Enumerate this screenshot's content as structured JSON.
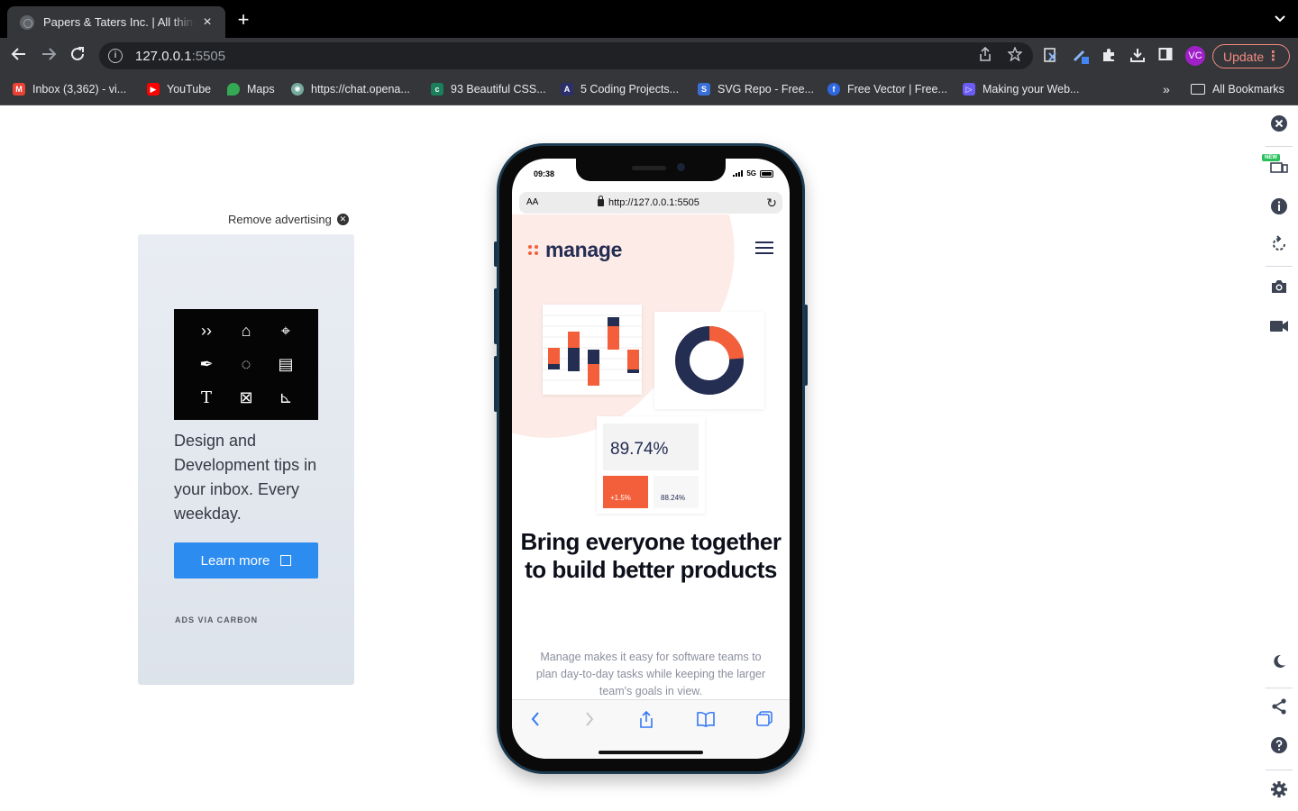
{
  "browser": {
    "tab_title": "Papers & Taters Inc. | All things",
    "tab_close": "×",
    "new_tab": "+",
    "url_host": "127.0.0.1",
    "url_port": ":5505",
    "update_label": "Update",
    "profile_initials": "VC",
    "bookmarks": [
      {
        "label": "Inbox (3,362) - vi...",
        "icon": "gmail-icon",
        "color": "#ea4335"
      },
      {
        "label": "YouTube",
        "icon": "youtube-icon",
        "color": "#ff0000"
      },
      {
        "label": "Maps",
        "icon": "maps-icon",
        "color": "#34a853"
      },
      {
        "label": "https://chat.opena...",
        "icon": "openai-icon",
        "color": "#74aa9c"
      },
      {
        "label": "93 Beautiful CSS...",
        "icon": "css-icon",
        "color": "#1a7f5a"
      },
      {
        "label": "5 Coding Projects...",
        "icon": "code-icon",
        "color": "#2b2f6b"
      },
      {
        "label": "SVG Repo - Free...",
        "icon": "svgrepo-icon",
        "color": "#3b6fd8"
      },
      {
        "label": "Free Vector | Free...",
        "icon": "freepik-icon",
        "color": "#2f67e0"
      },
      {
        "label": "Making your Web...",
        "icon": "bookmark-icon",
        "color": "#6b5cf6"
      }
    ],
    "all_bookmarks": "All Bookmarks"
  },
  "ad": {
    "remove_label": "Remove advertising",
    "text": "Design and Development tips in your inbox. Every weekday.",
    "button_label": "Learn more",
    "footer": "ADS VIA CARBON"
  },
  "phone": {
    "time": "09:38",
    "network": "5G",
    "aa_label": "AA",
    "url": "http://127.0.0.1:5505",
    "logo_text": "manage",
    "stat_main": "89.74%",
    "stat_change": "+1.5%",
    "stat_secondary": "88.24%",
    "headline": "Bring everyone together to build better products",
    "subtext": "Manage makes it easy for software teams to plan day-to-day tasks while keeping the larger team's goals in view.",
    "accent_color": "#f25f3a",
    "navy_color": "#242d52"
  },
  "side_panel": {
    "new_badge": "NEW",
    "icons": [
      "close-icon",
      "devices-icon",
      "info-icon",
      "rotate-icon",
      "camera-icon",
      "video-icon",
      "dark-mode-icon",
      "share-icon",
      "help-icon",
      "settings-icon"
    ]
  }
}
